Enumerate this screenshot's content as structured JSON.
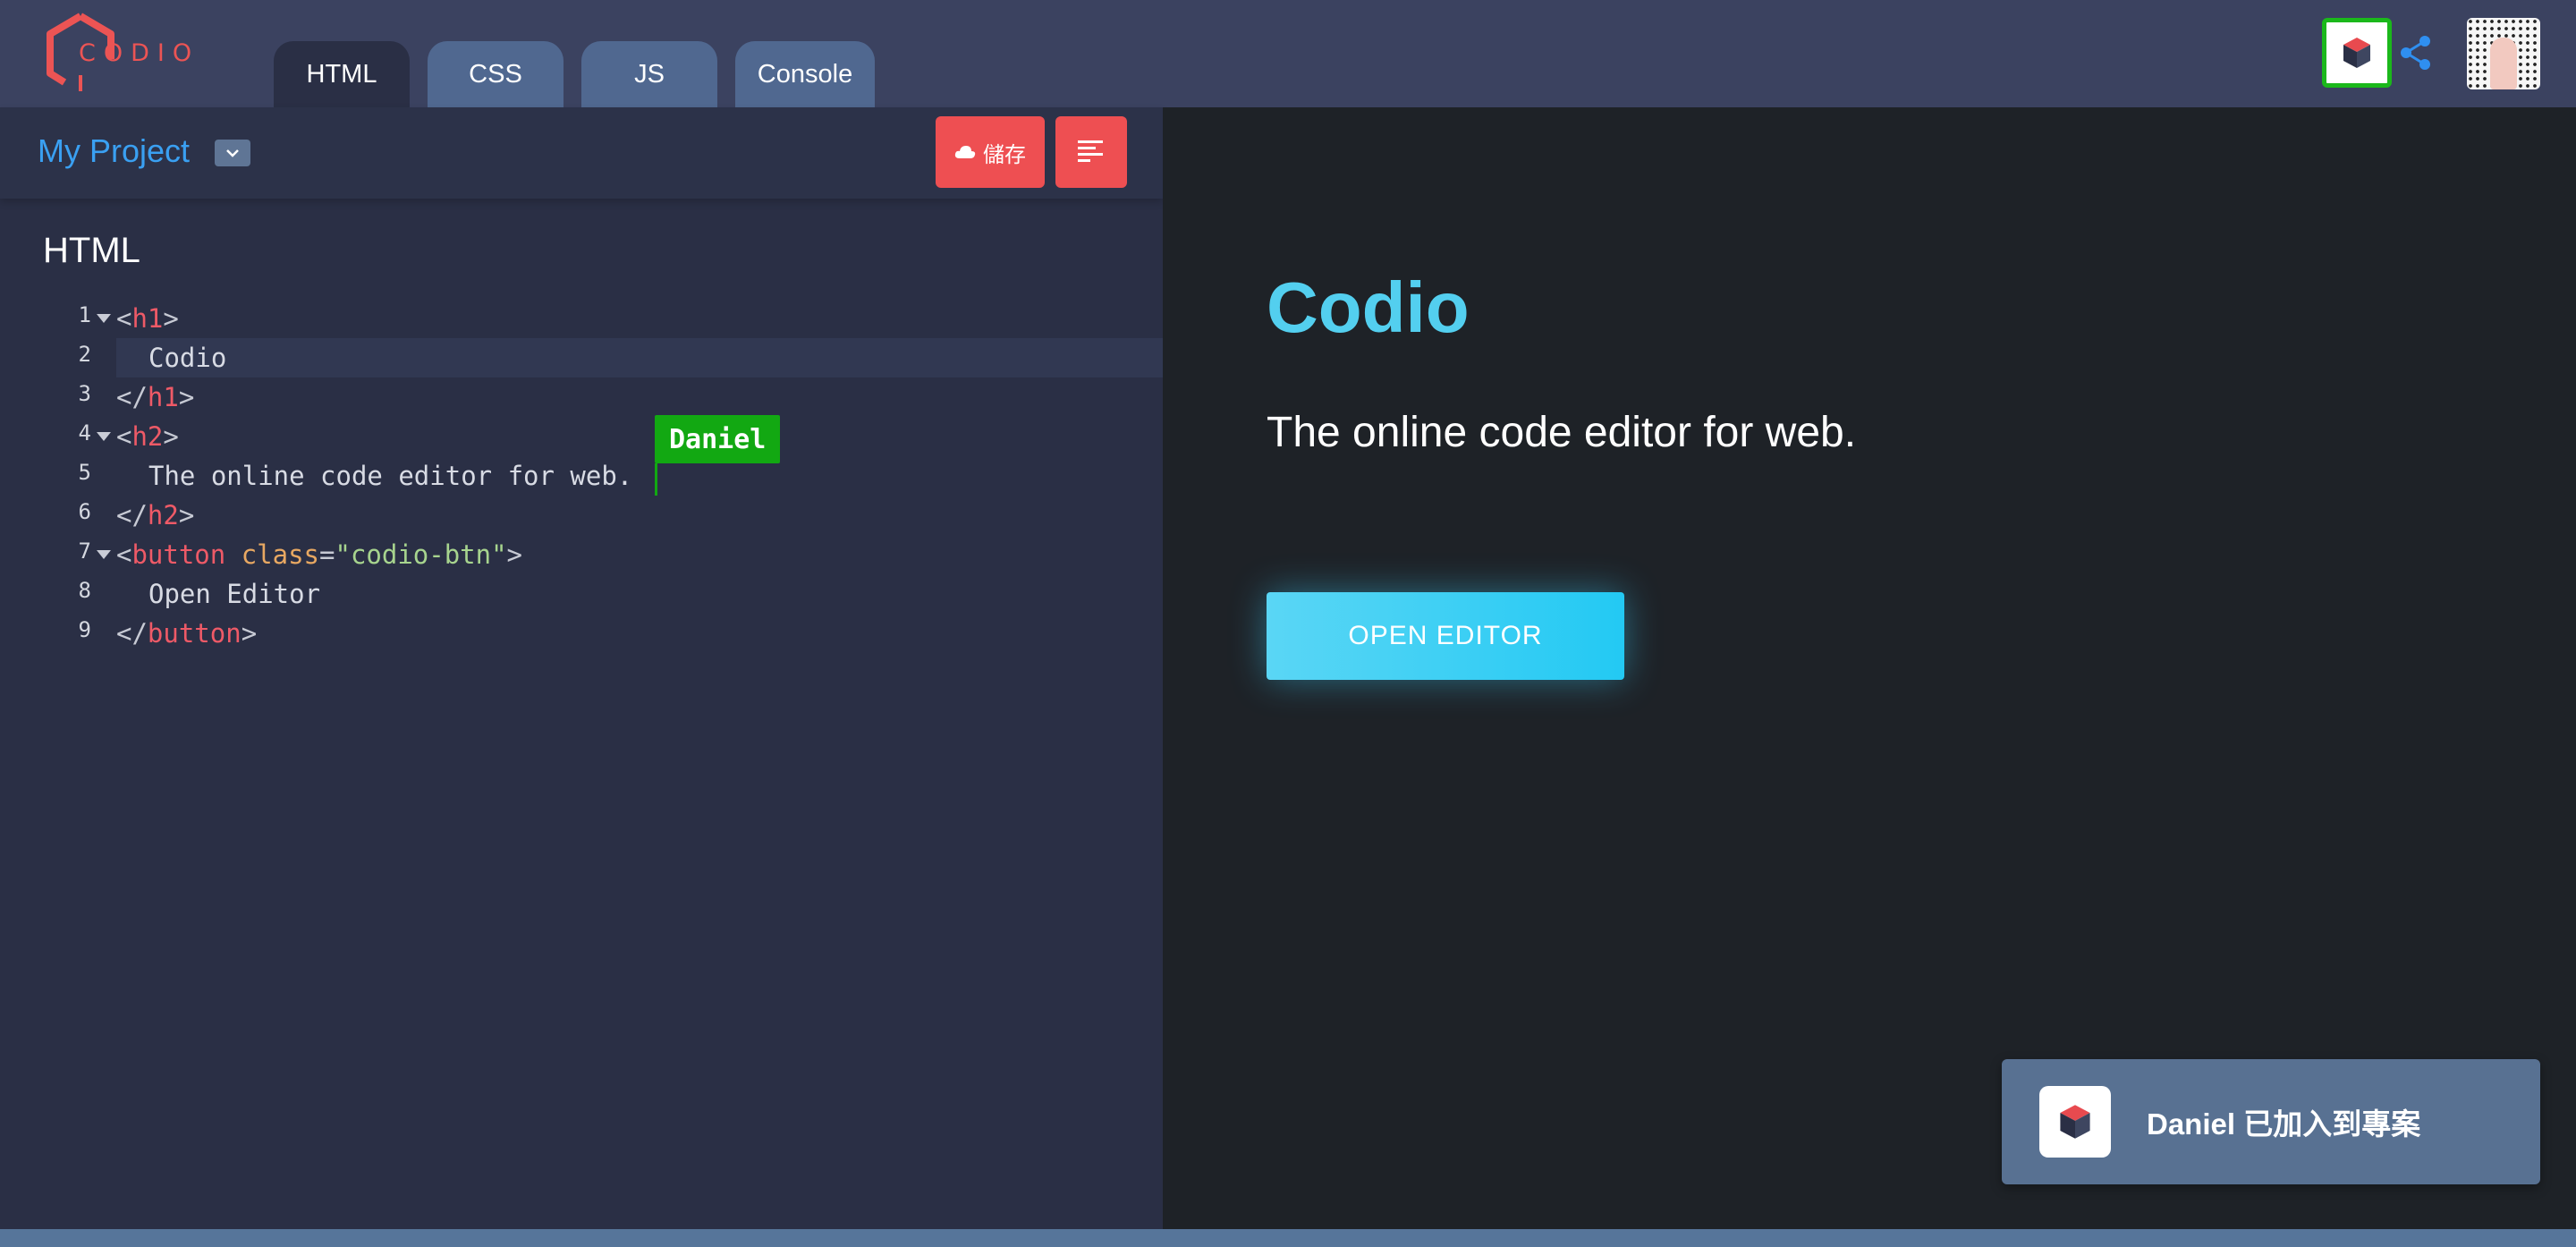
{
  "app": {
    "logo_text": "CODIO",
    "accent_color": "#ec5454"
  },
  "tabs": [
    {
      "label": "HTML",
      "active": true
    },
    {
      "label": "CSS",
      "active": false
    },
    {
      "label": "JS",
      "active": false
    },
    {
      "label": "Console",
      "active": false
    }
  ],
  "header_right": {
    "presence_icon": "cube-icon",
    "share_icon": "share-icon",
    "avatar_icon": "user-avatar"
  },
  "project": {
    "name": "My Project",
    "dropdown_icon": "chevron-down-icon",
    "save_label": "儲存",
    "save_icon": "cloud-icon",
    "format_icon": "align-left-icon"
  },
  "editor": {
    "heading": "HTML",
    "line_numbers": [
      "1",
      "2",
      "3",
      "4",
      "5",
      "6",
      "7",
      "8",
      "9"
    ],
    "lines": {
      "l1_open": "<",
      "l1_tag": "h1",
      "l1_close": ">",
      "l2_text": "Codio",
      "l3_open": "</",
      "l3_tag": "h1",
      "l3_close": ">",
      "l4_open": "<",
      "l4_tag": "h2",
      "l4_close": ">",
      "l5_text": "The online code editor for web.",
      "l6_open": "</",
      "l6_tag": "h2",
      "l6_close": ">",
      "l7_open": "<",
      "l7_tag": "button",
      "l7_attr": "class",
      "l7_eq": "=",
      "l7_str": "\"codio-btn\"",
      "l7_close": ">",
      "l8_text": "Open Editor",
      "l9_open": "</",
      "l9_tag": "button",
      "l9_close": ">"
    },
    "collaborator_cursor": {
      "name": "Daniel",
      "color": "#12a812"
    }
  },
  "preview": {
    "title": "Codio",
    "subtitle": "The online code editor for web.",
    "button_label": "OPEN EDITOR"
  },
  "toast": {
    "message": "Daniel 已加入到專案",
    "icon": "cube-icon"
  }
}
